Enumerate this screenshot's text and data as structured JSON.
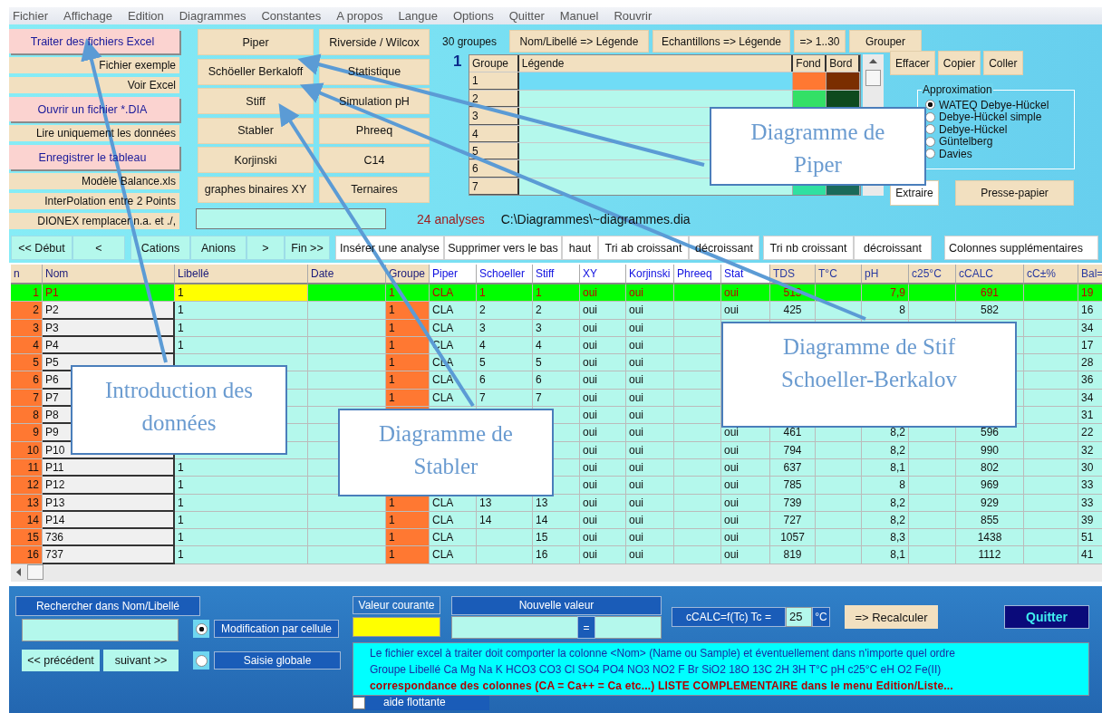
{
  "menu": [
    "Fichier",
    "Affichage",
    "Edition",
    "Diagrammes",
    "Constantes",
    "A propos",
    "Langue",
    "Options",
    "Quitter",
    "Manuel",
    "Rouvrir"
  ],
  "file_buttons": [
    {
      "label": "Traiter des fichiers Excel",
      "kind": "primary"
    },
    {
      "label": "Fichier exemple",
      "kind": "secondary"
    },
    {
      "label": "Voir Excel",
      "kind": "secondary"
    },
    {
      "label": "Ouvrir un fichier *.DIA",
      "kind": "primary"
    },
    {
      "label": "Lire uniquement les données",
      "kind": "secondary"
    },
    {
      "label": "Enregistrer le tableau",
      "kind": "primary"
    },
    {
      "label": "Modèle Balance.xls",
      "kind": "secondary"
    },
    {
      "label": "InterPolation entre 2 Points",
      "kind": "secondary"
    },
    {
      "label": "DIONEX remplacer n.a. et ./,",
      "kind": "secondary"
    }
  ],
  "diagram_buttons": [
    "Piper",
    "Riverside / Wilcox",
    "Schöeller Berkaloff",
    "Statistique",
    "Stiff",
    "Simulation pH",
    "Stabler",
    "Phreeq",
    "Korjinski",
    "C14",
    "graphes binaires XY",
    "Ternaires"
  ],
  "analyses_count": "24 analyses",
  "file_path": "C:\\Diagrammes\\~diagrammes.dia",
  "groups": {
    "count_label": "30 groupes",
    "buttons": [
      "Nom/Libellé => Légende",
      "Echantillons => Légende",
      "=> 1..30",
      "Grouper"
    ],
    "current": "1",
    "columns": [
      "Groupe",
      "Légende",
      "Fond",
      "Bord"
    ],
    "rows": [
      {
        "group": "1",
        "selected": true,
        "fill": {
          "color": "#ff7832"
        },
        "border": {
          "color": "#7a2e00"
        }
      },
      {
        "group": "2",
        "selected": false,
        "fill": {
          "color": "#33e066"
        },
        "border": {
          "color": "#0e4a1e"
        }
      },
      {
        "group": "3",
        "selected": false
      },
      {
        "group": "4",
        "selected": false
      },
      {
        "group": "5",
        "selected": false
      },
      {
        "group": "6",
        "selected": false
      },
      {
        "group": "7",
        "selected": false,
        "fill": {
          "color": "#30e0a0"
        },
        "border": {
          "color": "#1a6a5a"
        }
      }
    ]
  },
  "group_actions": [
    "Effacer",
    "Copier",
    "Coller"
  ],
  "approximation": {
    "title": "Approximation",
    "options": [
      {
        "label": "WATEQ Debye-Hückel",
        "selected": true
      },
      {
        "label": "Debye-Hückel simple",
        "selected": false
      },
      {
        "label": "Debye-Hückel",
        "selected": false
      },
      {
        "label": "Güntelberg",
        "selected": false
      },
      {
        "label": "Davies",
        "selected": false
      }
    ]
  },
  "extract_buttons": [
    "Extraire",
    "Presse-papier"
  ],
  "toolbar": [
    {
      "label": "<< Début",
      "kind": "nav"
    },
    {
      "label": "<",
      "kind": "nav"
    },
    {
      "label": "Cations",
      "kind": "nav"
    },
    {
      "label": "Anions",
      "kind": "nav"
    },
    {
      "label": ">",
      "kind": "nav"
    },
    {
      "label": "Fin >>",
      "kind": "nav"
    },
    {
      "label": "Insérer une analyse",
      "kind": "action"
    },
    {
      "label": "Supprimer vers le bas",
      "kind": "action"
    },
    {
      "label": "haut",
      "kind": "action"
    },
    {
      "label": "Tri ab croissant",
      "kind": "action"
    },
    {
      "label": "décroissant",
      "kind": "action"
    },
    {
      "label": "Tri nb croissant",
      "kind": "action"
    },
    {
      "label": "décroissant",
      "kind": "action"
    },
    {
      "label": "Colonnes supplémentaires",
      "kind": "action"
    }
  ],
  "table": {
    "columns": [
      {
        "label": "n",
        "kind": "key"
      },
      {
        "label": "Nom",
        "kind": "key"
      },
      {
        "label": "Libellé",
        "kind": "key"
      },
      {
        "label": "Date",
        "kind": "key"
      },
      {
        "label": "Groupe",
        "kind": "key"
      },
      {
        "label": "Piper",
        "kind": "flag"
      },
      {
        "label": "Schoeller",
        "kind": "flag"
      },
      {
        "label": "Stiff",
        "kind": "flag"
      },
      {
        "label": "XY",
        "kind": "flag"
      },
      {
        "label": "Korjinski",
        "kind": "flag"
      },
      {
        "label": "Phreeq",
        "kind": "flag"
      },
      {
        "label": "Stat",
        "kind": "flag"
      },
      {
        "label": "TDS",
        "kind": "measure"
      },
      {
        "label": "T°C",
        "kind": "measure"
      },
      {
        "label": "pH",
        "kind": "measure"
      },
      {
        "label": "c25°C",
        "kind": "measure"
      },
      {
        "label": "cCALC",
        "kind": "measure"
      },
      {
        "label": "cC±%",
        "kind": "measure"
      },
      {
        "label": "Bal=",
        "kind": "measure"
      }
    ],
    "rows": [
      {
        "selected": true,
        "cells": [
          "1",
          "P1",
          "1",
          null,
          "1",
          "CLA",
          "1",
          "1",
          "oui",
          "oui",
          null,
          "oui",
          "513",
          null,
          "7,9",
          null,
          "691",
          null,
          "19"
        ]
      },
      {
        "selected": false,
        "cells": [
          "2",
          "P2",
          "1",
          null,
          "1",
          "CLA",
          "2",
          "2",
          "oui",
          "oui",
          null,
          "oui",
          "425",
          null,
          "8",
          null,
          "582",
          null,
          "16"
        ]
      },
      {
        "selected": false,
        "cells": [
          "3",
          "P3",
          "1",
          null,
          "1",
          "CLA",
          "3",
          "3",
          "oui",
          "oui",
          null,
          null,
          null,
          null,
          null,
          null,
          null,
          null,
          "34"
        ]
      },
      {
        "selected": false,
        "cells": [
          "4",
          "P4",
          "1",
          null,
          "1",
          "CLA",
          "4",
          "4",
          "oui",
          "oui",
          null,
          null,
          null,
          null,
          null,
          null,
          null,
          null,
          "17"
        ]
      },
      {
        "selected": false,
        "cells": [
          "5",
          "P5",
          null,
          null,
          "1",
          "CLA",
          "5",
          "5",
          "oui",
          "oui",
          null,
          null,
          null,
          null,
          null,
          null,
          null,
          null,
          "28"
        ]
      },
      {
        "selected": false,
        "cells": [
          "6",
          "P6",
          null,
          null,
          "1",
          "CLA",
          "6",
          "6",
          "oui",
          "oui",
          null,
          null,
          null,
          null,
          null,
          null,
          null,
          null,
          "36"
        ]
      },
      {
        "selected": false,
        "cells": [
          "7",
          "P7",
          null,
          null,
          "1",
          "CLA",
          "7",
          "7",
          "oui",
          "oui",
          null,
          null,
          null,
          null,
          null,
          null,
          null,
          null,
          "34"
        ]
      },
      {
        "selected": false,
        "cells": [
          "8",
          "P8",
          null,
          null,
          null,
          null,
          null,
          null,
          "oui",
          "oui",
          null,
          null,
          null,
          null,
          null,
          null,
          null,
          null,
          "31"
        ]
      },
      {
        "selected": false,
        "cells": [
          "9",
          "P9",
          null,
          null,
          null,
          null,
          null,
          null,
          "oui",
          "oui",
          null,
          "oui",
          "461",
          null,
          "8,2",
          null,
          "596",
          null,
          "22"
        ]
      },
      {
        "selected": false,
        "cells": [
          "10",
          "P10",
          null,
          null,
          null,
          null,
          null,
          null,
          "oui",
          "oui",
          null,
          "oui",
          "794",
          null,
          "8,2",
          null,
          "990",
          null,
          "32"
        ]
      },
      {
        "selected": false,
        "cells": [
          "11",
          "P11",
          "1",
          null,
          null,
          null,
          null,
          null,
          "oui",
          "oui",
          null,
          "oui",
          "637",
          null,
          "8,1",
          null,
          "802",
          null,
          "30"
        ]
      },
      {
        "selected": false,
        "cells": [
          "12",
          "P12",
          "1",
          null,
          null,
          null,
          null,
          null,
          "oui",
          "oui",
          null,
          "oui",
          "785",
          null,
          "8",
          null,
          "969",
          null,
          "33"
        ]
      },
      {
        "selected": false,
        "cells": [
          "13",
          "P13",
          "1",
          null,
          "1",
          "CLA",
          "13",
          "13",
          "oui",
          "oui",
          null,
          "oui",
          "739",
          null,
          "8,2",
          null,
          "929",
          null,
          "33"
        ]
      },
      {
        "selected": false,
        "cells": [
          "14",
          "P14",
          "1",
          null,
          "1",
          "CLA",
          "14",
          "14",
          "oui",
          "oui",
          null,
          "oui",
          "727",
          null,
          "8,2",
          null,
          "855",
          null,
          "39"
        ]
      },
      {
        "selected": false,
        "cells": [
          "15",
          "736",
          "1",
          null,
          "1",
          "CLA",
          null,
          "15",
          "oui",
          "oui",
          null,
          "oui",
          "1057",
          null,
          "8,3",
          null,
          "1438",
          null,
          "51"
        ]
      },
      {
        "selected": false,
        "cells": [
          "16",
          "737",
          "1",
          null,
          "1",
          "CLA",
          null,
          "16",
          "oui",
          "oui",
          null,
          "oui",
          "819",
          null,
          "8,1",
          null,
          "1112",
          null,
          "41"
        ]
      }
    ]
  },
  "search": {
    "label": "Rechercher dans Nom/Libellé",
    "buttons": [
      "<< précédent",
      "suivant >>"
    ]
  },
  "edit_mode": [
    {
      "label": "Modification par cellule",
      "selected": true
    },
    {
      "label": "Saisie globale",
      "selected": false
    }
  ],
  "current_value": {
    "label": "Valeur courante"
  },
  "new_value": {
    "label": "Nouvelle valeur",
    "button": "="
  },
  "temperature": {
    "label": "cCALC=f(Tc)  Tc =",
    "value": "25",
    "unit": "°C"
  },
  "recalc_button": "=> Recalculer",
  "quit_button": "Quitter",
  "info": [
    {
      "text": "Le fichier excel à traiter doit comporter la colonne <Nom> (Name ou Sample) et éventuellement dans n'importe quel ordre",
      "kind": "normal"
    },
    {
      "text": "Groupe Libellé Ca Mg Na K HCO3 CO3 Cl SO4 PO4 NO3 NO2 F Br SiO2 18O 13C 2H 3H T°C pH c25°C eH O2 Fe(II)",
      "kind": "normal"
    },
    {
      "text": "correspondance des colonnes (CA = Ca++ = Ca etc...) LISTE COMPLEMENTAIRE dans le menu Edition/Liste...",
      "kind": "warning"
    }
  ],
  "floating_help": {
    "label": "aide flottante",
    "checked": false
  },
  "callouts": [
    {
      "lines": [
        "Diagramme de",
        "Piper"
      ]
    },
    {
      "lines": [
        "Diagramme de Stif",
        "Schoeller-Berkalov"
      ]
    },
    {
      "lines": [
        "Introduction des",
        "données"
      ]
    },
    {
      "lines": [
        "Diagramme de",
        "Stabler"
      ]
    }
  ]
}
